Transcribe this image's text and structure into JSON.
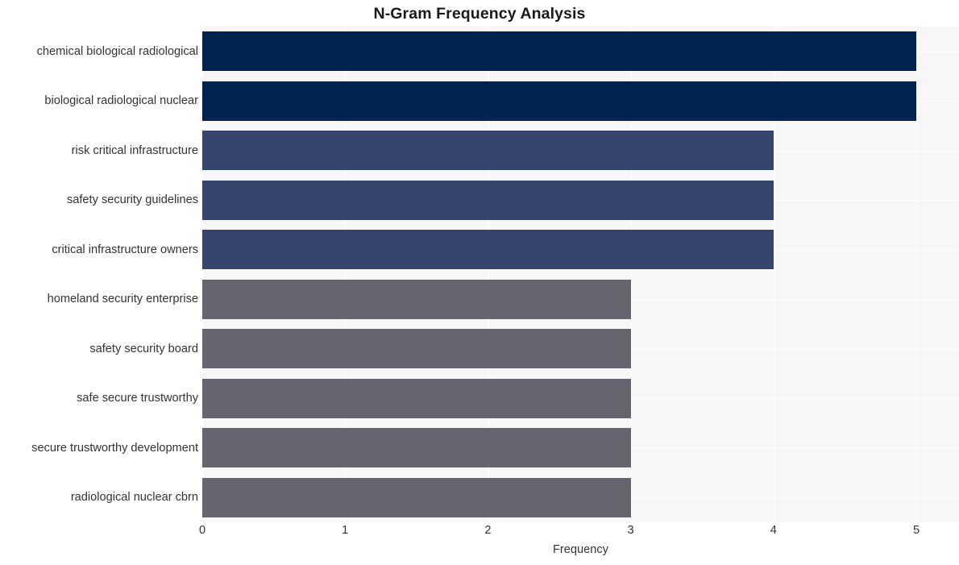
{
  "chart_data": {
    "type": "bar",
    "orientation": "horizontal",
    "title": "N-Gram Frequency Analysis",
    "xlabel": "Frequency",
    "ylabel": "",
    "xlim": [
      0,
      5.3
    ],
    "xticks": [
      0,
      1,
      2,
      3,
      4,
      5
    ],
    "xtick_labels": [
      "0",
      "1",
      "2",
      "3",
      "4",
      "5"
    ],
    "grid": true,
    "legend": false,
    "categories": [
      "chemical biological radiological",
      "biological radiological nuclear",
      "risk critical infrastructure",
      "safety security guidelines",
      "critical infrastructure owners",
      "homeland security enterprise",
      "safety security board",
      "safe secure trustworthy",
      "secure trustworthy development",
      "radiological nuclear cbrn"
    ],
    "values": [
      5,
      5,
      4,
      4,
      4,
      3,
      3,
      3,
      3,
      3
    ],
    "bar_colors": [
      "#00244f",
      "#00244f",
      "#36456e",
      "#36456e",
      "#36456e",
      "#64656e",
      "#64656e",
      "#64656e",
      "#64656e",
      "#64656e"
    ],
    "plot_background": "#f7f7f7",
    "grid_color": "#ffffff",
    "figure_background": "#ffffff",
    "text_color": "#333333",
    "title_color": "#1a1a1a"
  }
}
